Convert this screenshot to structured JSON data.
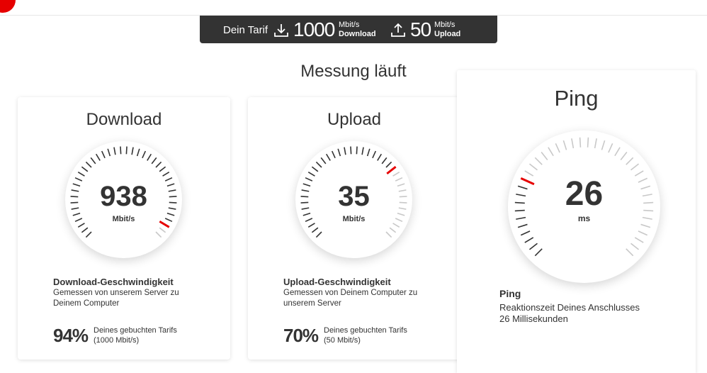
{
  "tariff": {
    "label": "Dein Tarif",
    "download_value": "1000",
    "download_unit": "Mbit/s",
    "download_label": "Download",
    "upload_value": "50",
    "upload_unit": "Mbit/s",
    "upload_label": "Upload"
  },
  "status": {
    "title": "Messung läuft"
  },
  "download": {
    "title": "Download",
    "value": "938",
    "unit": "Mbit/s",
    "gauge_fraction": 0.94,
    "label": "Download-Geschwindigkeit",
    "desc_line1": "Gemessen von unserem Server zu",
    "desc_line2": "Deinem Computer",
    "percent": "94%",
    "pct_line1": "Deines gebuchten Tarifs",
    "pct_line2": "(1000 Mbit/s)"
  },
  "upload": {
    "title": "Upload",
    "value": "35",
    "unit": "Mbit/s",
    "gauge_fraction": 0.7,
    "label": "Upload-Geschwindigkeit",
    "desc_line1": "Gemessen von Deinem Computer zu",
    "desc_line2": "unserem Server",
    "percent": "70%",
    "pct_line1": "Deines gebuchten Tarifs",
    "pct_line2": "(50 Mbit/s)"
  },
  "ping": {
    "title": "Ping",
    "value": "26",
    "unit": "ms",
    "gauge_fraction": 0.26,
    "label": "Ping",
    "desc_line1": "Reaktionszeit Deines Anschlusses",
    "desc_line2": "26 Millisekunden"
  },
  "colors": {
    "accent": "#e60000",
    "dark": "#333333",
    "tick_active": "#333333",
    "tick_inactive": "#c8c8c8"
  },
  "icons": [
    "download-icon",
    "upload-icon",
    "brand-logo"
  ]
}
